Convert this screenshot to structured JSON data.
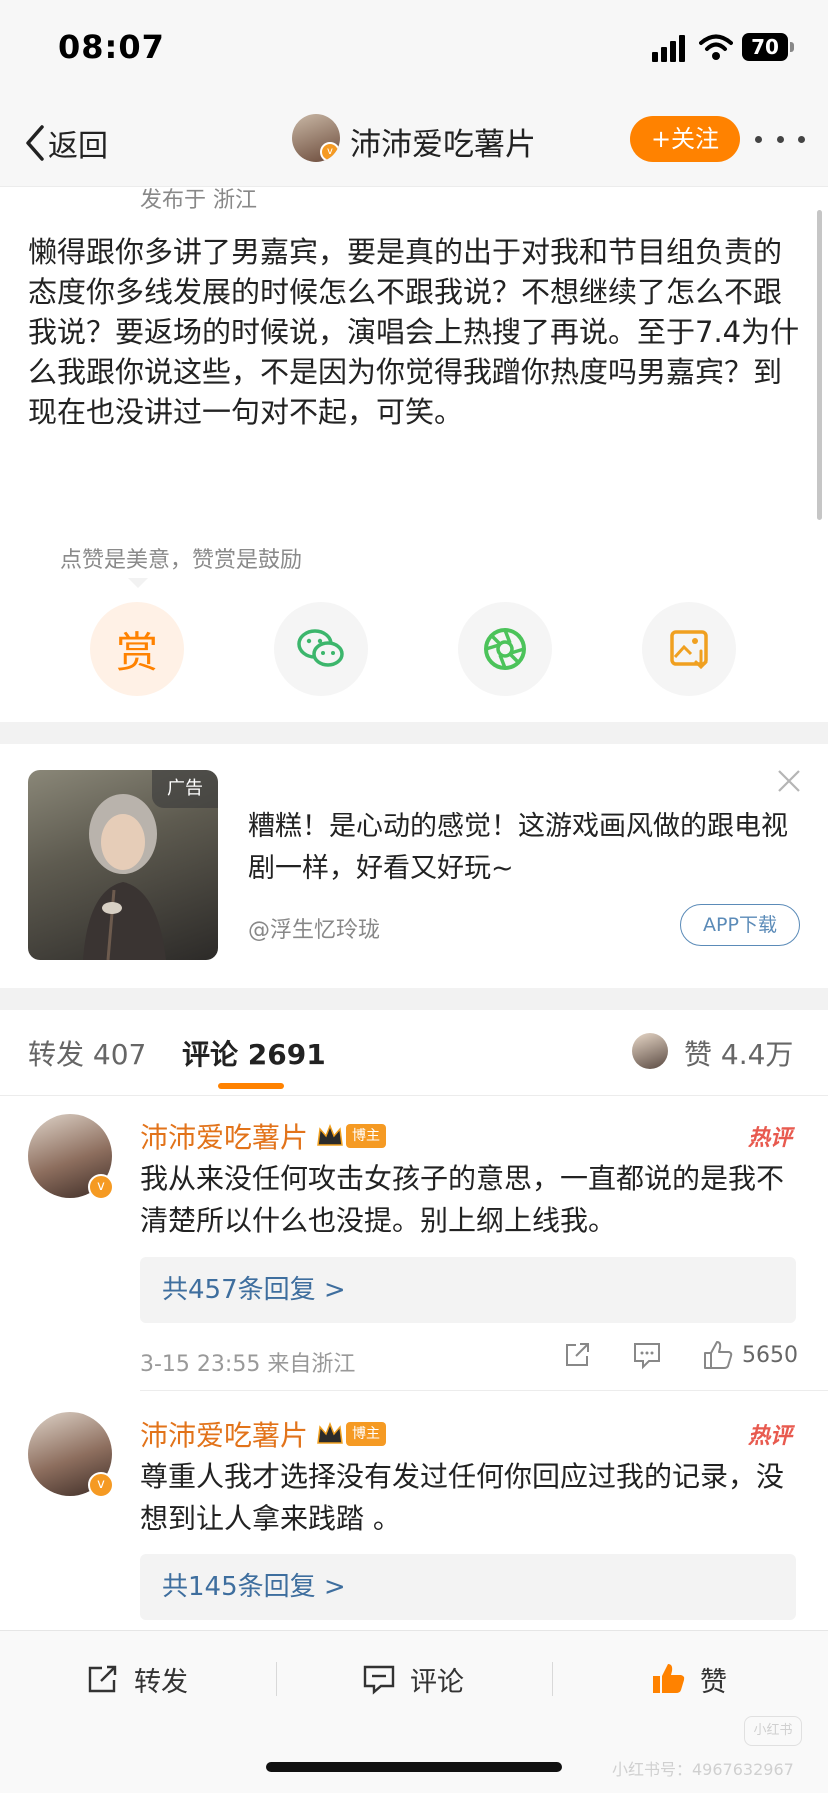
{
  "status_bar": {
    "time": "08:07",
    "battery": "70"
  },
  "nav": {
    "back_label": "返回",
    "title": "沛沛爱吃薯片",
    "follow_label": "+关注"
  },
  "post": {
    "published_from": "发布于 浙江",
    "body": "懒得跟你多讲了男嘉宾，要是真的出于对我和节目组负责的态度你多线发展的时候怎么不跟我说？不想继续了怎么不跟我说？要返场的时候说，演唱会上热搜了再说。至于7.4为什么我跟你说这些，不是因为你觉得我蹭你热度吗男嘉宾？到现在也没讲过一句对不起，可笑。",
    "reward_hint": "点赞是美意，赞赏是鼓励",
    "reward_char": "赏"
  },
  "ad": {
    "tag": "广告",
    "text": "糟糕！是心动的感觉！这游戏画风做的跟电视剧一样，好看又好玩~",
    "source": "@浮生忆玲珑",
    "button": "APP下载"
  },
  "tabs": {
    "repost": "转发 407",
    "comments": "评论 2691",
    "likes": "赞 4.4万"
  },
  "comments": [
    {
      "name": "沛沛爱吃薯片",
      "badge": "博主",
      "hot": "热评",
      "text": "我从来没任何攻击女孩子的意思，一直都说的是我不清楚所以什么也没提。别上纲上线我。",
      "replies": "共457条回复 >",
      "meta": "3-15 23:55 来自浙江",
      "likes": "5650"
    },
    {
      "name": "沛沛爱吃薯片",
      "badge": "博主",
      "hot": "热评",
      "text": "尊重人我才选择没有发过任何你回应过我的记录，没想到让人拿来践踏 。",
      "replies": "共145条回复 >"
    }
  ],
  "toolbar": {
    "repost": "转发",
    "comment": "评论",
    "like": "赞"
  },
  "watermark": {
    "text": "小红书号：4967632967",
    "logo": "小红书"
  },
  "colors": {
    "accent": "#ff8200",
    "name": "#e2731a",
    "link": "#3e6e9e",
    "hot": "#e85a4f"
  }
}
